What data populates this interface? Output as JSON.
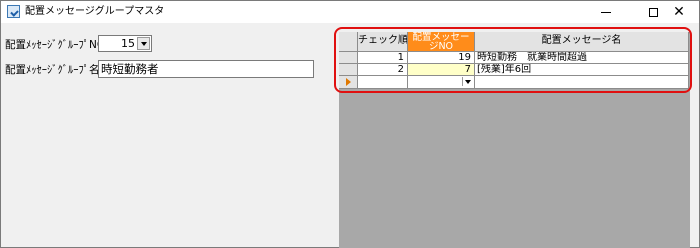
{
  "window": {
    "title": "配置メッセージグループマスタ",
    "controls": {
      "minimize": "",
      "maximize": "",
      "close": "✕"
    }
  },
  "form": {
    "group_no_label": "配置ﾒｯｾｰｼﾞｸﾞﾙｰﾌﾟNO",
    "group_no_value": "15",
    "group_name_label": "配置ﾒｯｾｰｼﾞｸﾞﾙｰﾌﾟ名",
    "group_name_value": "時短勤務者"
  },
  "grid": {
    "headers": [
      "チェック順",
      "配置メッセージNO",
      "配置メッセージ名"
    ],
    "header_no_line1": "配置メッセー",
    "header_no_line2": "ジNO",
    "rows": [
      {
        "order": "1",
        "message_no": "19",
        "message_name": "時短勤務　就業時間超過"
      },
      {
        "order": "2",
        "message_no": "7",
        "message_name": "[残業]年6回"
      },
      {
        "order": "",
        "message_no": "",
        "message_name": ""
      }
    ]
  },
  "colors": {
    "header_accent": "#ff8c1a",
    "selected_cell": "#ffffc8",
    "highlight_border": "#e01010",
    "row_pointer": "#e07800"
  }
}
